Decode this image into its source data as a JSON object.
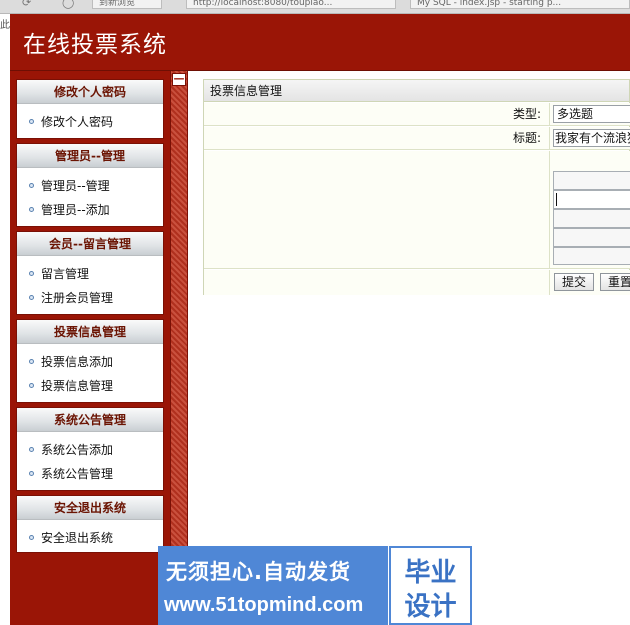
{
  "browser": {
    "tabs": [
      "到新浏览",
      "http://localhost:8080/toupiao...",
      "My SQL - index.jsp - starting p..."
    ],
    "left_char": "此"
  },
  "header": {
    "title": "在线投票系统"
  },
  "sidebar": {
    "groups": [
      {
        "title": "修改个人密码",
        "items": [
          "修改个人密码"
        ]
      },
      {
        "title": "管理员--管理",
        "items": [
          "管理员--管理",
          "管理员--添加"
        ]
      },
      {
        "title": "会员--留言管理",
        "items": [
          "留言管理",
          "注册会员管理"
        ]
      },
      {
        "title": "投票信息管理",
        "items": [
          "投票信息添加",
          "投票信息管理"
        ]
      },
      {
        "title": "系统公告管理",
        "items": [
          "系统公告添加",
          "系统公告管理"
        ]
      },
      {
        "title": "安全退出系统",
        "items": [
          "安全退出系统"
        ]
      }
    ]
  },
  "divider": {
    "collapse_symbol": "—"
  },
  "panel": {
    "title": "投票信息管理",
    "type_label": "类型:",
    "type_value": "多选题",
    "title_label": "标题:",
    "title_value": "我家有个流浪狗",
    "submit_label": "提交",
    "reset_label": "重置"
  },
  "watermark": {
    "line1": "无须担心.自动发货",
    "line2": "www.51topmind.com",
    "badge_line1": "毕业",
    "badge_line2": "设计"
  },
  "colors": {
    "brand_red": "#9a1506",
    "watermark_blue": "#4f87d6"
  }
}
